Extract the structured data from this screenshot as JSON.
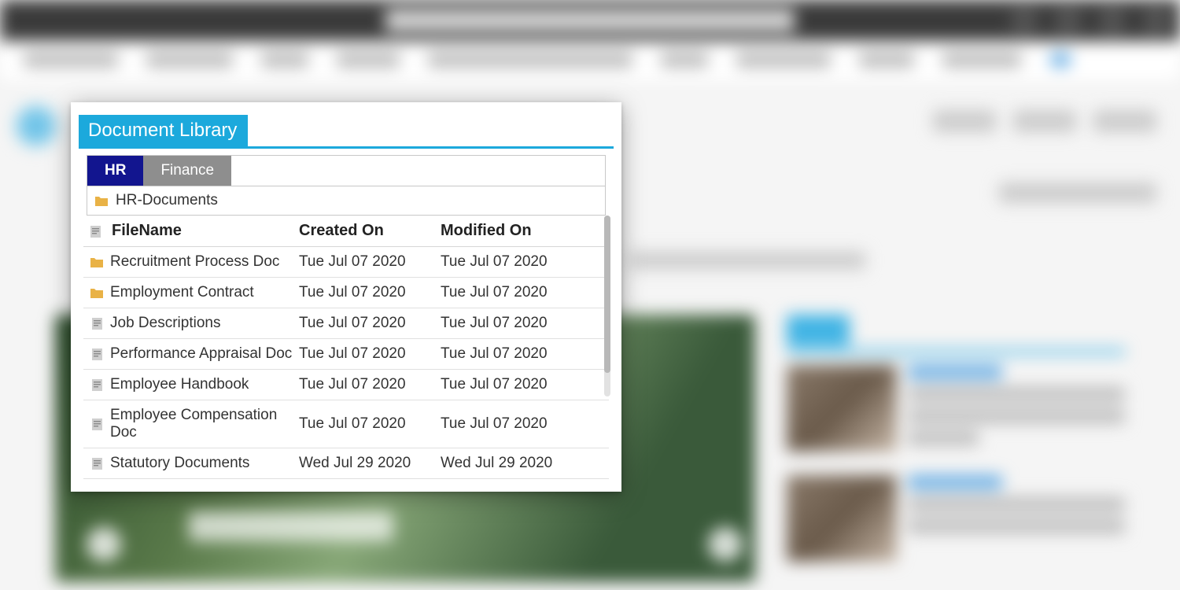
{
  "panel": {
    "title": "Document Library",
    "tabs": [
      {
        "label": "HR",
        "active": true
      },
      {
        "label": "Finance",
        "active": false
      }
    ],
    "folder": "HR-Documents",
    "columns": {
      "filename": "FileName",
      "created": "Created On",
      "modified": "Modified On"
    },
    "rows": [
      {
        "icon": "folder",
        "name": "Recruitment Process Doc",
        "created": "Tue Jul 07 2020",
        "modified": "Tue Jul 07 2020"
      },
      {
        "icon": "folder",
        "name": "Employment Contract",
        "created": "Tue Jul 07 2020",
        "modified": "Tue Jul 07 2020"
      },
      {
        "icon": "doc",
        "name": "Job Descriptions",
        "created": "Tue Jul 07 2020",
        "modified": "Tue Jul 07 2020"
      },
      {
        "icon": "doc",
        "name": "Performance Appraisal Doc",
        "created": "Tue Jul 07 2020",
        "modified": "Tue Jul 07 2020"
      },
      {
        "icon": "doc",
        "name": "Employee Handbook",
        "created": "Tue Jul 07 2020",
        "modified": "Tue Jul 07 2020"
      },
      {
        "icon": "doc",
        "name": "Employee Compensation Doc",
        "created": "Tue Jul 07 2020",
        "modified": "Tue Jul 07 2020"
      },
      {
        "icon": "doc",
        "name": "Statutory Documents",
        "created": "Wed Jul 29 2020",
        "modified": "Wed Jul 29 2020"
      }
    ]
  }
}
